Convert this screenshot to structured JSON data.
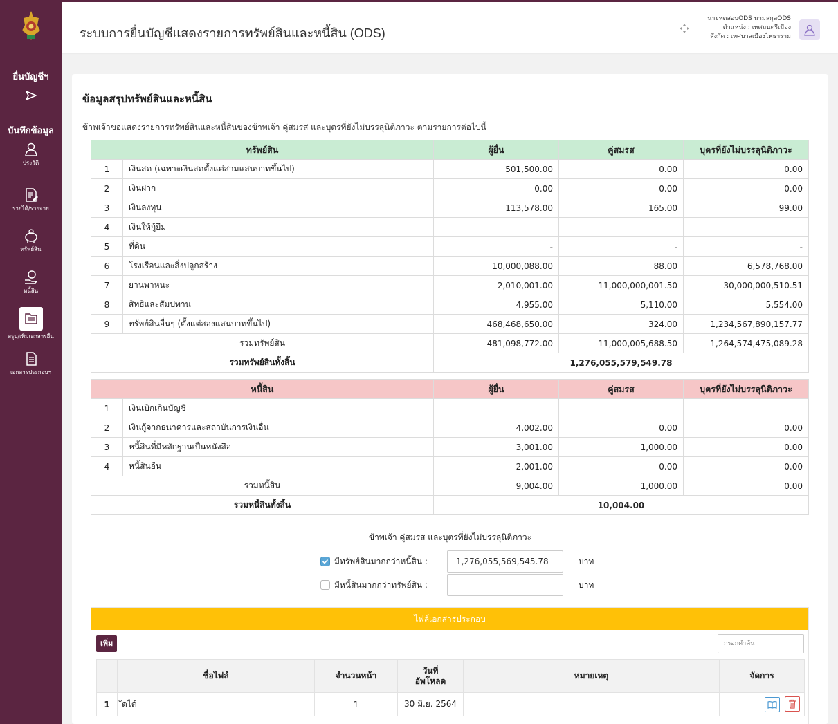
{
  "header": {
    "title": "ระบบการยื่นบัญชีแสดงรายการทรัพย์สินและหนี้สิน (ODS)",
    "user_name": "นายทดสอบODS นามสกุลODS",
    "position": "ตำแหน่ง : เทศมนตรีเมือง",
    "affiliation": "สังกัด : เทศบาลเมืองโพธาราม"
  },
  "sidebar": {
    "submit_label": "ยื่นบัญชีฯ",
    "record_label": "บันทึกข้อมูล",
    "items": [
      {
        "label": "ประวัติ",
        "icon": "person-icon"
      },
      {
        "label": "รายได้/รายจ่าย",
        "icon": "document-edit-icon"
      },
      {
        "label": "ทรัพย์สิน",
        "icon": "piggy-bank-icon"
      },
      {
        "label": "หนี้สิน",
        "icon": "hand-coin-icon"
      },
      {
        "label": "สรุป/เพิ่มเอกสารอื่น",
        "icon": "folder-summary-icon"
      },
      {
        "label": "เอกสารประกอบฯ",
        "icon": "document-icon"
      }
    ]
  },
  "main": {
    "section_title": "ข้อมูลสรุปทรัพย์สินและหนี้สิน",
    "declaration": "ข้าพเจ้าขอแสดงรายการทรัพย์สินและหนี้สินของข้าพเจ้า คู่สมรส และบุตรที่ยังไม่บรรลุนิติภาวะ ตามรายการต่อไปนี้",
    "assets": {
      "headers": [
        "ทรัพย์สิน",
        "ผู้ยื่น",
        "คู่สมรส",
        "บุตรที่ยังไม่บรรลุนิติภาวะ"
      ],
      "rows": [
        {
          "no": "1",
          "name": "เงินสด (เฉพาะเงินสดตั้งแต่สามแสนบาทขึ้นไป)",
          "filer": "501,500.00",
          "spouse": "0.00",
          "child": "0.00"
        },
        {
          "no": "2",
          "name": "เงินฝาก",
          "filer": "0.00",
          "spouse": "0.00",
          "child": "0.00"
        },
        {
          "no": "3",
          "name": "เงินลงทุน",
          "filer": "113,578.00",
          "spouse": "165.00",
          "child": "99.00"
        },
        {
          "no": "4",
          "name": "เงินให้กู้ยืม",
          "filer": "-",
          "spouse": "-",
          "child": "-"
        },
        {
          "no": "5",
          "name": "ที่ดิน",
          "filer": "-",
          "spouse": "-",
          "child": "-"
        },
        {
          "no": "6",
          "name": "โรงเรือนและสิ่งปลูกสร้าง",
          "filer": "10,000,088.00",
          "spouse": "88.00",
          "child": "6,578,768.00"
        },
        {
          "no": "7",
          "name": "ยานพาหนะ",
          "filer": "2,010,001.00",
          "spouse": "11,000,000,001.50",
          "child": "30,000,000,510.51"
        },
        {
          "no": "8",
          "name": "สิทธิและสัมปทาน",
          "filer": "4,955.00",
          "spouse": "5,110.00",
          "child": "5,554.00"
        },
        {
          "no": "9",
          "name": "ทรัพย์สินอื่นๆ (ตั้งแต่สองแสนบาทขึ้นไป)",
          "filer": "468,468,650.00",
          "spouse": "324.00",
          "child": "1,234,567,890,157.77"
        }
      ],
      "subtotal_label": "รวมทรัพย์สิน",
      "subtotal": {
        "filer": "481,098,772.00",
        "spouse": "11,000,005,688.50",
        "child": "1,264,574,475,089.28"
      },
      "total_label": "รวมทรัพย์สินทั้งสิ้น",
      "total": "1,276,055,579,549.78"
    },
    "liabilities": {
      "headers": [
        "หนี้สิน",
        "ผู้ยื่น",
        "คู่สมรส",
        "บุตรที่ยังไม่บรรลุนิติภาวะ"
      ],
      "rows": [
        {
          "no": "1",
          "name": "เงินเบิกเกินบัญชี",
          "filer": "-",
          "spouse": "-",
          "child": "-"
        },
        {
          "no": "2",
          "name": "เงินกู้จากธนาคารและสถาบันการเงินอื่น",
          "filer": "4,002.00",
          "spouse": "0.00",
          "child": "0.00"
        },
        {
          "no": "3",
          "name": "หนี้สินที่มีหลักฐานเป็นหนังสือ",
          "filer": "3,001.00",
          "spouse": "1,000.00",
          "child": "0.00"
        },
        {
          "no": "4",
          "name": "หนี้สินอื่น",
          "filer": "2,001.00",
          "spouse": "0.00",
          "child": "0.00"
        }
      ],
      "subtotal_label": "รวมหนี้สิน",
      "subtotal": {
        "filer": "9,004.00",
        "spouse": "1,000.00",
        "child": "0.00"
      },
      "total_label": "รวมหนี้สินทั้งสิ้น",
      "total": "10,004.00"
    },
    "comparison": {
      "title": "ข้าพเจ้า คู่สมรส และบุตรที่ยังไม่บรรลุนิติภาวะ",
      "more_assets_label": "มีทรัพย์สินมากกว่าหนี้สิน :",
      "more_assets_checked": true,
      "more_assets_value": "1,276,055,569,545.78",
      "more_liabilities_label": "มีหนี้สินมากกว่าทรัพย์สิน :",
      "more_liabilities_checked": false,
      "more_liabilities_value": "",
      "unit": "บาท"
    },
    "files": {
      "title": "ไฟล์เอกสารประกอบ",
      "add_label": "เพิ่ม",
      "search_placeholder": "กรอกคำค้น",
      "headers": {
        "name": "ชื่อไฟล์",
        "pages": "จำนวนหน้า",
        "date_line1": "วันที่",
        "date_line2": "อัพโหลด",
        "note": "หมายเหตุ",
        "manage": "จัดการ"
      },
      "rows": [
        {
          "no": "1",
          "name": "ัดได้",
          "pages": "1",
          "date": "30 มิ.ย. 2564",
          "note": ""
        }
      ]
    }
  },
  "colors": {
    "sidebar": "#5b2541",
    "asset_header": "#c9ecd3",
    "liability_header": "#f6c6c7",
    "file_header": "#ffc107",
    "checkbox_on": "#5aa6d6"
  }
}
